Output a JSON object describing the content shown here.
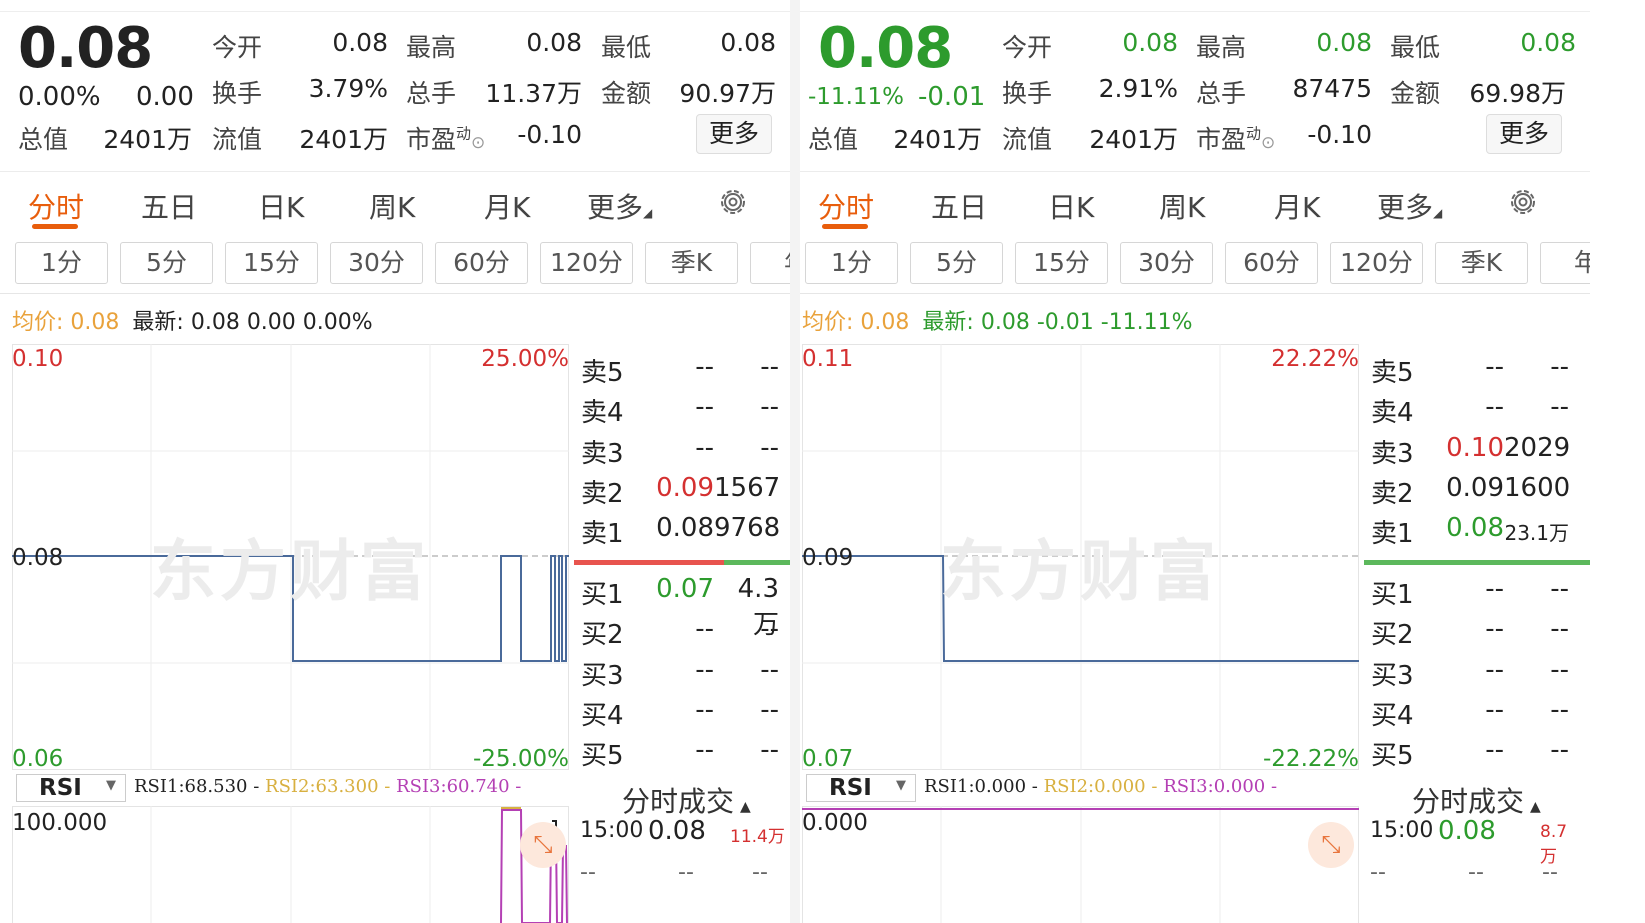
{
  "panes": [
    {
      "price": "0.08",
      "price_color": "#222222",
      "change_pct": "0.00%",
      "change_abs": "0.00",
      "change_color": "#222222",
      "quote": {
        "open_label": "今开",
        "open": "0.08",
        "high_label": "最高",
        "high": "0.08",
        "low_label": "最低",
        "low": "0.08",
        "turnover_label": "换手",
        "turnover": "3.79%",
        "volume_label": "总手",
        "volume": "11.37万",
        "amount_label": "金额",
        "amount": "90.97万",
        "mktcap_label": "总值",
        "mktcap": "2401万",
        "float_label": "流值",
        "float": "2401万",
        "pe_label": "市盈",
        "pe_sup": "动",
        "pe": "-0.10",
        "more": "更多"
      },
      "tabs": [
        "分时",
        "五日",
        "日K",
        "周K",
        "月K",
        "更多"
      ],
      "periods": [
        "1分",
        "5分",
        "15分",
        "30分",
        "60分",
        "120分",
        "季K",
        "年"
      ],
      "info": {
        "avg_label": "均价:",
        "avg": "0.08",
        "latest_label": "最新:",
        "latest": "0.08",
        "latest_chg": "0.00",
        "latest_pct": "0.00%"
      },
      "chart": {
        "top_price": "0.10",
        "top_pct": "25.00%",
        "mid_price": "0.08",
        "bot_price": "0.06",
        "bot_pct": "-25.00%",
        "watermark": "东方财富"
      },
      "order_book": {
        "asks": [
          {
            "label": "卖5",
            "price": "--",
            "vol": "--"
          },
          {
            "label": "卖4",
            "price": "--",
            "vol": "--"
          },
          {
            "label": "卖3",
            "price": "--",
            "vol": "--"
          },
          {
            "label": "卖2",
            "price": "0.09",
            "vol": "1567"
          },
          {
            "label": "卖1",
            "price": "0.08",
            "vol": "9768"
          }
        ],
        "bids": [
          {
            "label": "买1",
            "price": "0.07",
            "vol": "4.3万"
          },
          {
            "label": "买2",
            "price": "--",
            "vol": "--"
          },
          {
            "label": "买3",
            "price": "--",
            "vol": "--"
          },
          {
            "label": "买4",
            "price": "--",
            "vol": "--"
          },
          {
            "label": "买5",
            "price": "--",
            "vol": "--"
          }
        ],
        "ratio": 0.7
      },
      "rsi": {
        "selector": "RSI",
        "rsi1": "RSI1:68.530 -",
        "rsi2": "RSI2:63.300 -",
        "rsi3": "RSI3:60.740 -",
        "top_value": "100.000"
      },
      "trade": {
        "title": "分时成交",
        "time": "15:00",
        "price": "0.08",
        "vol": "11.4万"
      }
    },
    {
      "price": "0.08",
      "price_color": "#2d9b2d",
      "change_pct": "-11.11%",
      "change_abs": "-0.01",
      "change_color": "#2d9b2d",
      "quote": {
        "open_label": "今开",
        "open": "0.08",
        "high_label": "最高",
        "high": "0.08",
        "low_label": "最低",
        "low": "0.08",
        "turnover_label": "换手",
        "turnover": "2.91%",
        "volume_label": "总手",
        "volume": "87475",
        "amount_label": "金额",
        "amount": "69.98万",
        "mktcap_label": "总值",
        "mktcap": "2401万",
        "float_label": "流值",
        "float": "2401万",
        "pe_label": "市盈",
        "pe_sup": "动",
        "pe": "-0.10",
        "more": "更多"
      },
      "tabs": [
        "分时",
        "五日",
        "日K",
        "周K",
        "月K",
        "更多"
      ],
      "periods": [
        "1分",
        "5分",
        "15分",
        "30分",
        "60分",
        "120分",
        "季K",
        "年"
      ],
      "info": {
        "avg_label": "均价:",
        "avg": "0.08",
        "latest_label": "最新:",
        "latest": "0.08",
        "latest_chg": "-0.01",
        "latest_pct": "-11.11%"
      },
      "chart": {
        "top_price": "0.11",
        "top_pct": "22.22%",
        "mid_price": "0.09",
        "bot_price": "0.07",
        "bot_pct": "-22.22%",
        "watermark": "东方财富"
      },
      "order_book": {
        "asks": [
          {
            "label": "卖5",
            "price": "--",
            "vol": "--"
          },
          {
            "label": "卖4",
            "price": "--",
            "vol": "--"
          },
          {
            "label": "卖3",
            "price": "0.10",
            "vol": "2029"
          },
          {
            "label": "卖2",
            "price": "0.09",
            "vol": "1600"
          },
          {
            "label": "卖1",
            "price": "0.08",
            "vol": "23.1万"
          }
        ],
        "bids": [
          {
            "label": "买1",
            "price": "--",
            "vol": "--"
          },
          {
            "label": "买2",
            "price": "--",
            "vol": "--"
          },
          {
            "label": "买3",
            "price": "--",
            "vol": "--"
          },
          {
            "label": "买4",
            "price": "--",
            "vol": "--"
          },
          {
            "label": "买5",
            "price": "--",
            "vol": "--"
          }
        ],
        "ratio": 0.0
      },
      "rsi": {
        "selector": "RSI",
        "rsi1": "RSI1:0.000 -",
        "rsi2": "RSI2:0.000 -",
        "rsi3": "RSI3:0.000 -",
        "top_value": "0.000"
      },
      "trade": {
        "title": "分时成交",
        "time": "15:00",
        "price": "0.08",
        "vol": "8.7万"
      }
    }
  ],
  "colors": {
    "up": "#d43030",
    "down": "#2d9b2d",
    "accent": "#e85d0c",
    "line": "#4a6a9a",
    "avg": "#e9a23b"
  }
}
